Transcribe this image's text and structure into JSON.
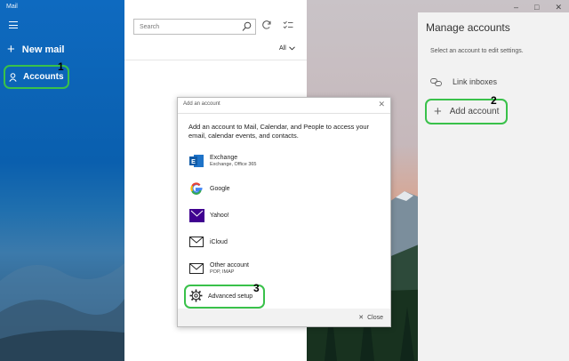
{
  "app": {
    "title": "Mail"
  },
  "nav": {
    "new_mail": "New mail",
    "accounts": "Accounts"
  },
  "list": {
    "search_placeholder": "Search",
    "filter": "All"
  },
  "manage": {
    "title": "Manage accounts",
    "subtitle": "Select an account to edit settings.",
    "link_inboxes": "Link inboxes",
    "add_account": "Add account"
  },
  "dialog": {
    "title": "Add an account",
    "description": "Add an account to Mail, Calendar, and People to access your email, calendar events, and contacts.",
    "providers": [
      {
        "name": "Exchange",
        "sub": "Exchange, Office 365",
        "icon": "exchange-icon"
      },
      {
        "name": "Google",
        "sub": "",
        "icon": "google-icon"
      },
      {
        "name": "Yahoo!",
        "sub": "",
        "icon": "yahoo-icon"
      },
      {
        "name": "iCloud",
        "sub": "",
        "icon": "mail-icon"
      },
      {
        "name": "Other account",
        "sub": "POP, IMAP",
        "icon": "mail-icon"
      },
      {
        "name": "Advanced setup",
        "sub": "",
        "icon": "gear-icon"
      }
    ],
    "close": "Close"
  },
  "steps": {
    "one": "1",
    "two": "2",
    "three": "3"
  },
  "colors": {
    "accent": "#0a64b4",
    "highlight": "#39c14a"
  }
}
